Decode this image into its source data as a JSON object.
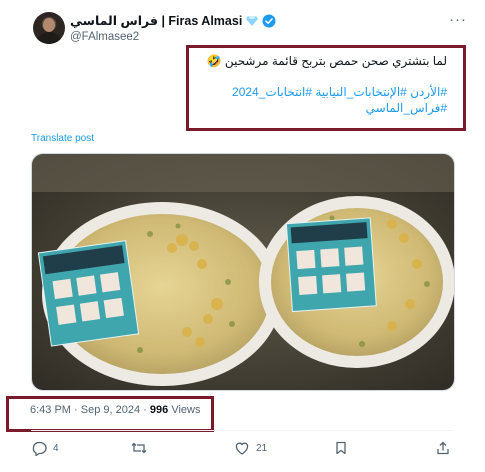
{
  "author": {
    "display_name": "فراس الماسي | Firas Almasi",
    "handle": "@FAlmasee2"
  },
  "tweet": {
    "text": "لما بتشتري صحن حمص بتربح قائمة مرشحين 🤣",
    "hashtags": [
      "#الأردن #الإنتخابات_النيابية #انتخابات_2024",
      "#فراس_الماسي"
    ]
  },
  "translate_label": "Translate post",
  "meta": {
    "time": "6:43 PM",
    "sep1": "·",
    "date": "Sep 9, 2024",
    "sep2": "·",
    "views_count": "996",
    "views_label": "Views"
  },
  "actions": {
    "replies": "4",
    "reposts": "",
    "likes": "21"
  },
  "colors": {
    "accent": "#1d9bf0",
    "highlight_box": "#7a1a2a",
    "verified": "#1d9bf0",
    "muted_text": "#536471"
  },
  "icons": [
    "more-icon",
    "diamond-icon",
    "verified-icon",
    "reply-icon",
    "repost-icon",
    "like-icon",
    "bookmark-icon",
    "share-icon"
  ]
}
